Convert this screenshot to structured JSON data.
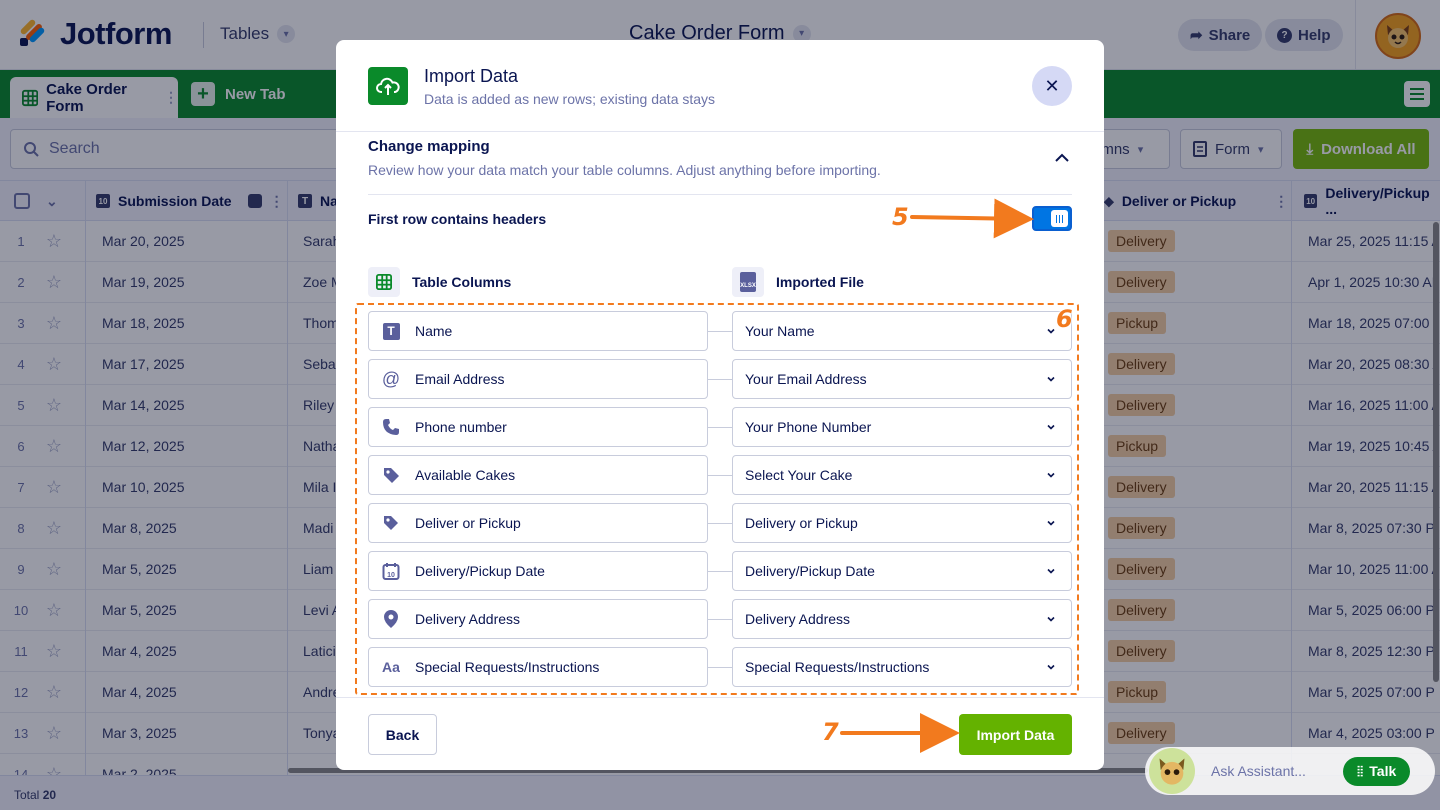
{
  "app": {
    "logo_text": "Jotform",
    "tables_label": "Tables",
    "form_title": "Cake Order Form",
    "share_label": "Share",
    "help_label": "Help"
  },
  "tabs": {
    "active_label": "Cake Order Form",
    "new_tab_label": "New Tab"
  },
  "toolbar": {
    "search_placeholder": "Search",
    "columns_label": "Columns",
    "columns_visible": "umns",
    "form_label": "Form",
    "download_label": "Download All"
  },
  "table": {
    "headers": {
      "submission_date": "Submission Date",
      "name": "Na",
      "deliver_or_pickup": "Deliver or Pickup",
      "delivery_date": "Delivery/Pickup ..."
    },
    "rows": [
      {
        "n": "1",
        "date": "Mar 20, 2025",
        "name": "Sarah",
        "deliver": "Delivery",
        "ddate": "Mar 25, 2025 11:15 A"
      },
      {
        "n": "2",
        "date": "Mar 19, 2025",
        "name": "Zoe M",
        "deliver": "Delivery",
        "ddate": "Apr 1, 2025 10:30 AM"
      },
      {
        "n": "3",
        "date": "Mar 18, 2025",
        "name": "Thom",
        "deliver": "Pickup",
        "ddate": "Mar 18, 2025 07:00 P"
      },
      {
        "n": "4",
        "date": "Mar 17, 2025",
        "name": "Sebas",
        "deliver": "Delivery",
        "ddate": "Mar 20, 2025 08:30 A"
      },
      {
        "n": "5",
        "date": "Mar 14, 2025",
        "name": "Riley",
        "deliver": "Delivery",
        "ddate": "Mar 16, 2025 11:00 A"
      },
      {
        "n": "6",
        "date": "Mar 12, 2025",
        "name": "Natha",
        "deliver": "Pickup",
        "ddate": "Mar 19, 2025 10:45 A"
      },
      {
        "n": "7",
        "date": "Mar 10, 2025",
        "name": "Mila I",
        "deliver": "Delivery",
        "ddate": "Mar 20, 2025 11:15 A"
      },
      {
        "n": "8",
        "date": "Mar 8, 2025",
        "name": "Madi",
        "deliver": "Delivery",
        "ddate": "Mar 8, 2025 07:30 P"
      },
      {
        "n": "9",
        "date": "Mar 5, 2025",
        "name": "Liam",
        "deliver": "Delivery",
        "ddate": "Mar 10, 2025 11:00 A"
      },
      {
        "n": "10",
        "date": "Mar 5, 2025",
        "name": "Levi A",
        "deliver": "Delivery",
        "ddate": "Mar 5, 2025 06:00 P"
      },
      {
        "n": "11",
        "date": "Mar 4, 2025",
        "name": "Latici",
        "deliver": "Delivery",
        "ddate": "Mar 8, 2025 12:30 P"
      },
      {
        "n": "12",
        "date": "Mar 4, 2025",
        "name": "Andre",
        "deliver": "Pickup",
        "ddate": "Mar 5, 2025 07:00 P"
      },
      {
        "n": "13",
        "date": "Mar 3, 2025",
        "name": "Tonya",
        "deliver": "Delivery",
        "ddate": "Mar 4, 2025 03:00 P"
      },
      {
        "n": "14",
        "date": "Mar 2, 2025",
        "name": "",
        "deliver": "",
        "ddate": ""
      }
    ],
    "total_label": "Total",
    "total_count": "20"
  },
  "assistant": {
    "placeholder": "Ask Assistant...",
    "talk_label": "Talk",
    "brand": "Jotform"
  },
  "modal": {
    "title": "Import Data",
    "subtitle": "Data is added as new rows; existing data stays",
    "section_title": "Change mapping",
    "section_subtitle": "Review how your data match your table columns. Adjust anything before importing.",
    "header_toggle_label": "First row contains headers",
    "header_toggle_on": true,
    "table_columns_label": "Table Columns",
    "imported_file_label": "Imported File",
    "file_badge": "XLSX",
    "mappings": [
      {
        "column": "Name",
        "icon": "text-icon",
        "source": "Your Name"
      },
      {
        "column": "Email Address",
        "icon": "at-icon",
        "source": "Your Email Address"
      },
      {
        "column": "Phone number",
        "icon": "phone-icon",
        "source": "Your Phone Number"
      },
      {
        "column": "Available Cakes",
        "icon": "tags-icon",
        "source": "Select Your Cake"
      },
      {
        "column": "Deliver or Pickup",
        "icon": "tag-icon",
        "source": "Delivery or Pickup"
      },
      {
        "column": "Delivery/Pickup Date",
        "icon": "calendar-icon",
        "source": "Delivery/Pickup Date"
      },
      {
        "column": "Delivery Address",
        "icon": "location-pin-icon",
        "source": "Delivery Address"
      },
      {
        "column": "Special Requests/Instructions",
        "icon": "textarea-icon",
        "source": "Special Requests/Instructions"
      }
    ],
    "back_label": "Back",
    "import_label": "Import Data"
  },
  "annotations": {
    "step5": "5",
    "step6": "6",
    "step7": "7",
    "color": "#f27a1e"
  },
  "colors": {
    "brand_green": "#0a8a2a",
    "button_green": "#64b200",
    "toggle_blue": "#0075e3",
    "tag_orange": "#f5cfa2",
    "navy": "#0a1551"
  }
}
